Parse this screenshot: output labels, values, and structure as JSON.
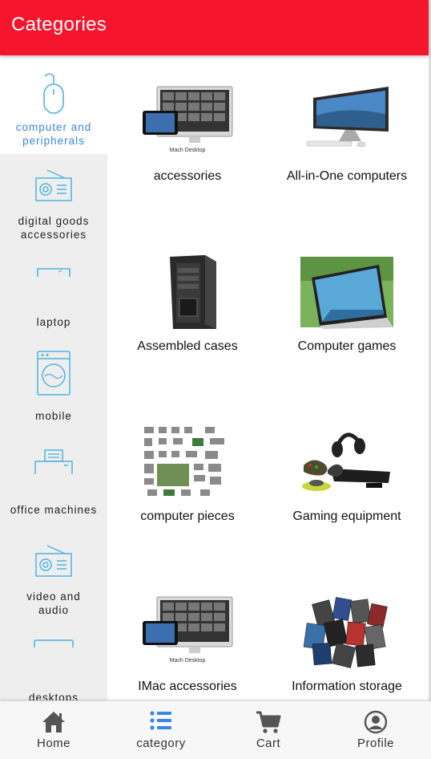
{
  "header": {
    "title": "Categories"
  },
  "colors": {
    "brand": "#f5152d",
    "accent": "#3a86e6",
    "icon_blue": "#4fb3e0",
    "sidebar_bg": "#eeeeee"
  },
  "sidebar": {
    "items": [
      {
        "label_line1": "computer and",
        "label_line2": "peripherals",
        "icon": "mouse-icon",
        "active": true
      },
      {
        "label_line1": "digital goods",
        "label_line2": "accessories",
        "icon": "radio-icon",
        "active": false
      },
      {
        "label_line1": "laptop",
        "label_line2": "",
        "icon": "laptop-icon",
        "active": false
      },
      {
        "label_line1": "mobile",
        "label_line2": "",
        "icon": "washing-machine-icon",
        "active": false
      },
      {
        "label_line1": "office machines",
        "label_line2": "",
        "icon": "printer-icon",
        "active": false
      },
      {
        "label_line1": "video and",
        "label_line2": "audio",
        "icon": "radio-icon",
        "active": false
      },
      {
        "label_line1": "desktops",
        "label_line2": "",
        "icon": "monitor-icon",
        "active": false
      }
    ]
  },
  "categories": [
    {
      "name": "accessories",
      "image": "imac-accessories-image"
    },
    {
      "name": "All-in-One computers",
      "image": "all-in-one-pc-image"
    },
    {
      "name": "Assembled cases",
      "image": "pc-case-image"
    },
    {
      "name": "Computer games",
      "image": "laptop-game-image"
    },
    {
      "name": "computer pieces",
      "image": "computer-parts-image"
    },
    {
      "name": "Gaming equipment",
      "image": "gaming-headset-image"
    },
    {
      "name": "IMac accessories",
      "image": "imac-accessories-image"
    },
    {
      "name": "Information storage",
      "image": "memory-cards-image"
    }
  ],
  "thumb_text": {
    "mach_desktop": "Mach Desktop"
  },
  "bottom_nav": {
    "items": [
      {
        "label": "Home",
        "icon": "home-icon"
      },
      {
        "label": "category",
        "icon": "list-icon"
      },
      {
        "label": "Cart",
        "icon": "cart-icon"
      },
      {
        "label": "Profile",
        "icon": "profile-icon"
      }
    ],
    "active_index": 1
  }
}
